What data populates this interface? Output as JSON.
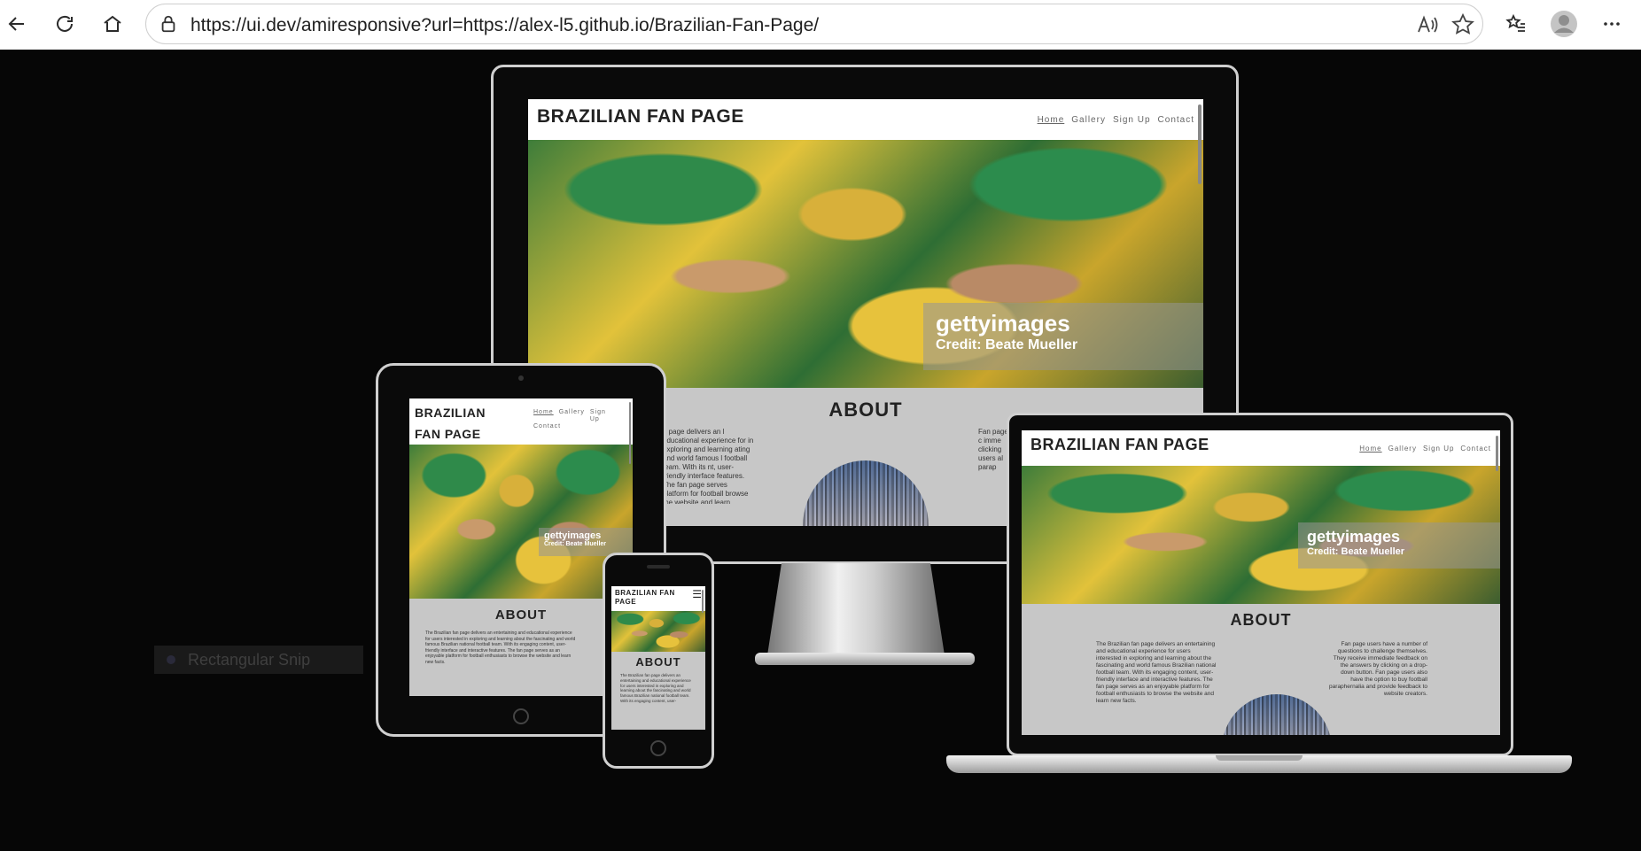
{
  "browser": {
    "url": "https://ui.dev/amiresponsive?url=https://alex-l5.github.io/Brazilian-Fan-Page/",
    "icons": [
      "back-arrow-icon",
      "refresh-icon",
      "home-icon",
      "lock-icon",
      "read-aloud-icon",
      "favorite-star-icon",
      "favorites-list-icon",
      "profile-icon",
      "more-icon"
    ]
  },
  "site": {
    "title": "BRAZILIAN FAN PAGE",
    "title_tablet": "BRAZILIAN FAN PAGE",
    "title_phone": "BRAZILIAN FAN PAGE",
    "nav": {
      "home": "Home",
      "gallery": "Gallery",
      "signup": "Sign Up",
      "contact": "Contact"
    },
    "getty_brand": "gettyimages",
    "getty_credit": "Credit: Beate Mueller",
    "about_heading": "ABOUT",
    "about_text": "The Brazilian fan page delivers an entertaining and educational experience for users interested in exploring and learning about the fascinating and world famous Brazilian national football team. With its engaging content, user-friendly interface and interactive features. The fan page serves as an enjoyable platform for football enthusiasts to browse the website and learn new facts.",
    "about_text_monitor_left": "n page delivers an l educational experience for in exploring and learning ating and world famous l football team. With its nt, user-friendly interface features. The fan page serves platform for football browse the website and learn",
    "about_text_monitor_right": "Fan page to c imme clicking users al parap",
    "about_text_right": "Fan page users have a number of questions to challenge themselves. They receive immediate feedback on the answers by clicking on a drop-down button. Fan page users also have the option to buy football paraphernalia and provide feedback to website creators.",
    "about_text_phone": "The Brazilian fan page delivers an entertaining and educational experience for users interested in exploring and learning about the fascinating and world famous Brazilian national football team. With its engaging content, user-"
  },
  "snip_label": "Rectangular Snip",
  "colors": {
    "viewport_bg": "#060606",
    "screen_bg": "#c7c7c7",
    "chrome_bg": "#ffffff"
  }
}
